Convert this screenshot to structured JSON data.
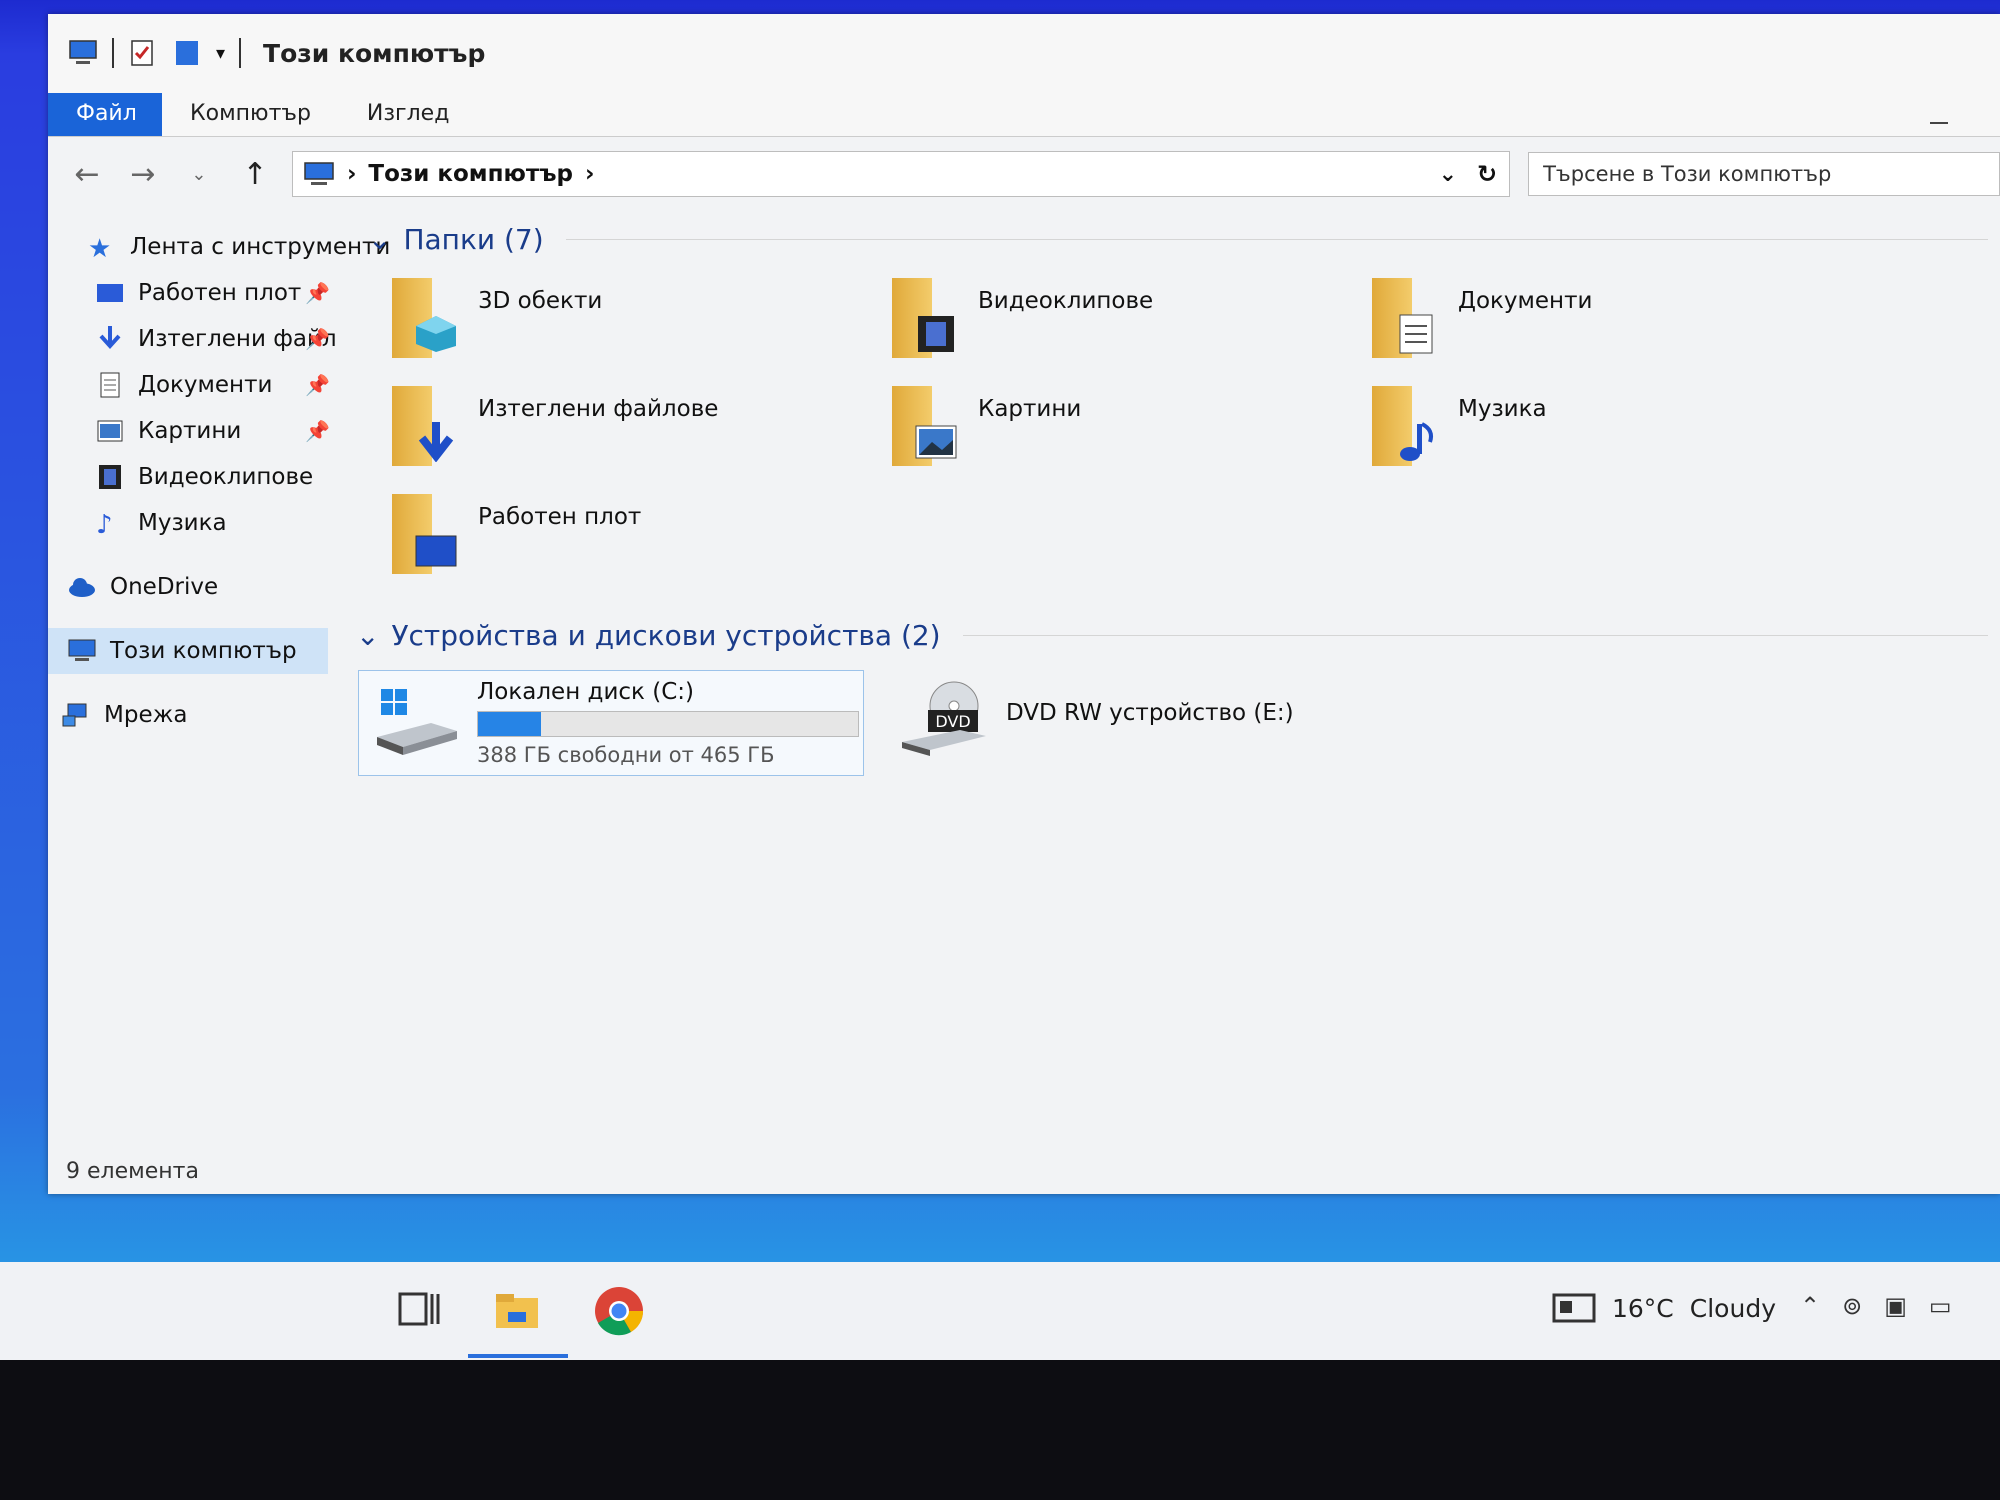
{
  "window": {
    "title": "Този компютър",
    "ribbon_tabs": [
      "Файл",
      "Компютър",
      "Изглед"
    ],
    "address": "Този компютър",
    "search_placeholder": "Търсене в Този компютър"
  },
  "sidebar": {
    "quick_access": "Лента с инструменти",
    "items": [
      {
        "label": "Работен плот",
        "icon": "desktop-icon"
      },
      {
        "label": "Изтеглени файл",
        "icon": "download-icon"
      },
      {
        "label": "Документи",
        "icon": "document-icon"
      },
      {
        "label": "Картини",
        "icon": "pictures-icon"
      },
      {
        "label": "Видеоклипове",
        "icon": "video-icon"
      },
      {
        "label": "Музика",
        "icon": "music-icon"
      }
    ],
    "onedrive": "OneDrive",
    "this_pc": "Този компютър",
    "network": "Мрежа"
  },
  "folders_section": "Папки (7)",
  "folders": [
    {
      "label": "3D обекти",
      "icon": "3d-objects-icon"
    },
    {
      "label": "Видеоклипове",
      "icon": "videos-folder-icon"
    },
    {
      "label": "Документи",
      "icon": "documents-folder-icon"
    },
    {
      "label": "Изтеглени файлове",
      "icon": "downloads-folder-icon"
    },
    {
      "label": "Картини",
      "icon": "pictures-folder-icon"
    },
    {
      "label": "Музика",
      "icon": "music-folder-icon"
    },
    {
      "label": "Работен плот",
      "icon": "desktop-folder-icon"
    }
  ],
  "devices_section": "Устройства и дискови устройства (2)",
  "drives": [
    {
      "label": "Локален диск (C:)",
      "free": "388 ГБ свободни от 465 ГБ",
      "used_fraction": 0.166
    },
    {
      "label": "DVD RW устройство (E:)",
      "badge": "DVD"
    }
  ],
  "status": "9 елемента",
  "taskbar": {
    "temperature": "16°C",
    "condition": "Cloudy"
  },
  "colors": {
    "accent": "#1a64d8",
    "folder": "#f0c35a",
    "selected": "#cfe3f7"
  }
}
